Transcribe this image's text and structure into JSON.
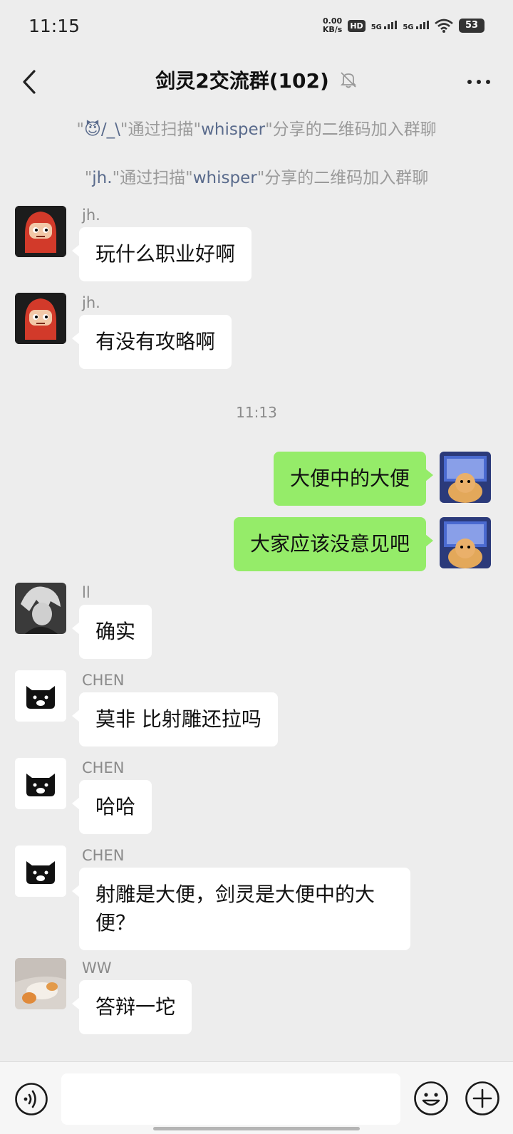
{
  "status_bar": {
    "time": "11:15",
    "speed_value": "0.00",
    "speed_unit": "KB/s",
    "hd_label": "HD",
    "sim1_label": "5G",
    "sim2_label": "5G",
    "battery": "53"
  },
  "header": {
    "title": "剑灵2交流群(102)",
    "icons": [
      "back-icon",
      "mute-bell-icon",
      "more-icon"
    ]
  },
  "system_notes": [
    {
      "prefix": "\"",
      "name": "😈/_\\",
      "middle": "\"通过扫描\"",
      "inviter": "whisper",
      "suffix": "\"分享的二维码加入群聊"
    },
    {
      "prefix": "\"",
      "name": "jh.",
      "middle": "\"通过扫描\"",
      "inviter": "whisper",
      "suffix": "\"分享的二维码加入群聊"
    }
  ],
  "timestamp": "11:13",
  "messages": [
    {
      "sender": "jh.",
      "text": "玩什么职业好啊",
      "self": false
    },
    {
      "sender": "jh.",
      "text": "有没有攻略啊",
      "self": false
    },
    {
      "sender": "",
      "text": "大便中的大便",
      "self": true
    },
    {
      "sender": "",
      "text": "大家应该没意见吧",
      "self": true
    },
    {
      "sender": "ll",
      "text": "确实",
      "self": false
    },
    {
      "sender": "CHEN",
      "text": "莫非 比射雕还拉吗",
      "self": false
    },
    {
      "sender": "CHEN",
      "text": "哈哈",
      "self": false
    },
    {
      "sender": "CHEN",
      "text": "射雕是大便，剑灵是大便中的大便？",
      "self": false
    },
    {
      "sender": "WW",
      "text": "答辩一坨",
      "self": false
    }
  ],
  "input_bar": {
    "value": "",
    "icons": [
      "voice-icon",
      "emoji-icon",
      "plus-icon"
    ]
  },
  "colors": {
    "background": "#ededed",
    "self_bubble": "#95ec69",
    "other_bubble": "#ffffff",
    "highlight_name": "#5a6b8c"
  }
}
